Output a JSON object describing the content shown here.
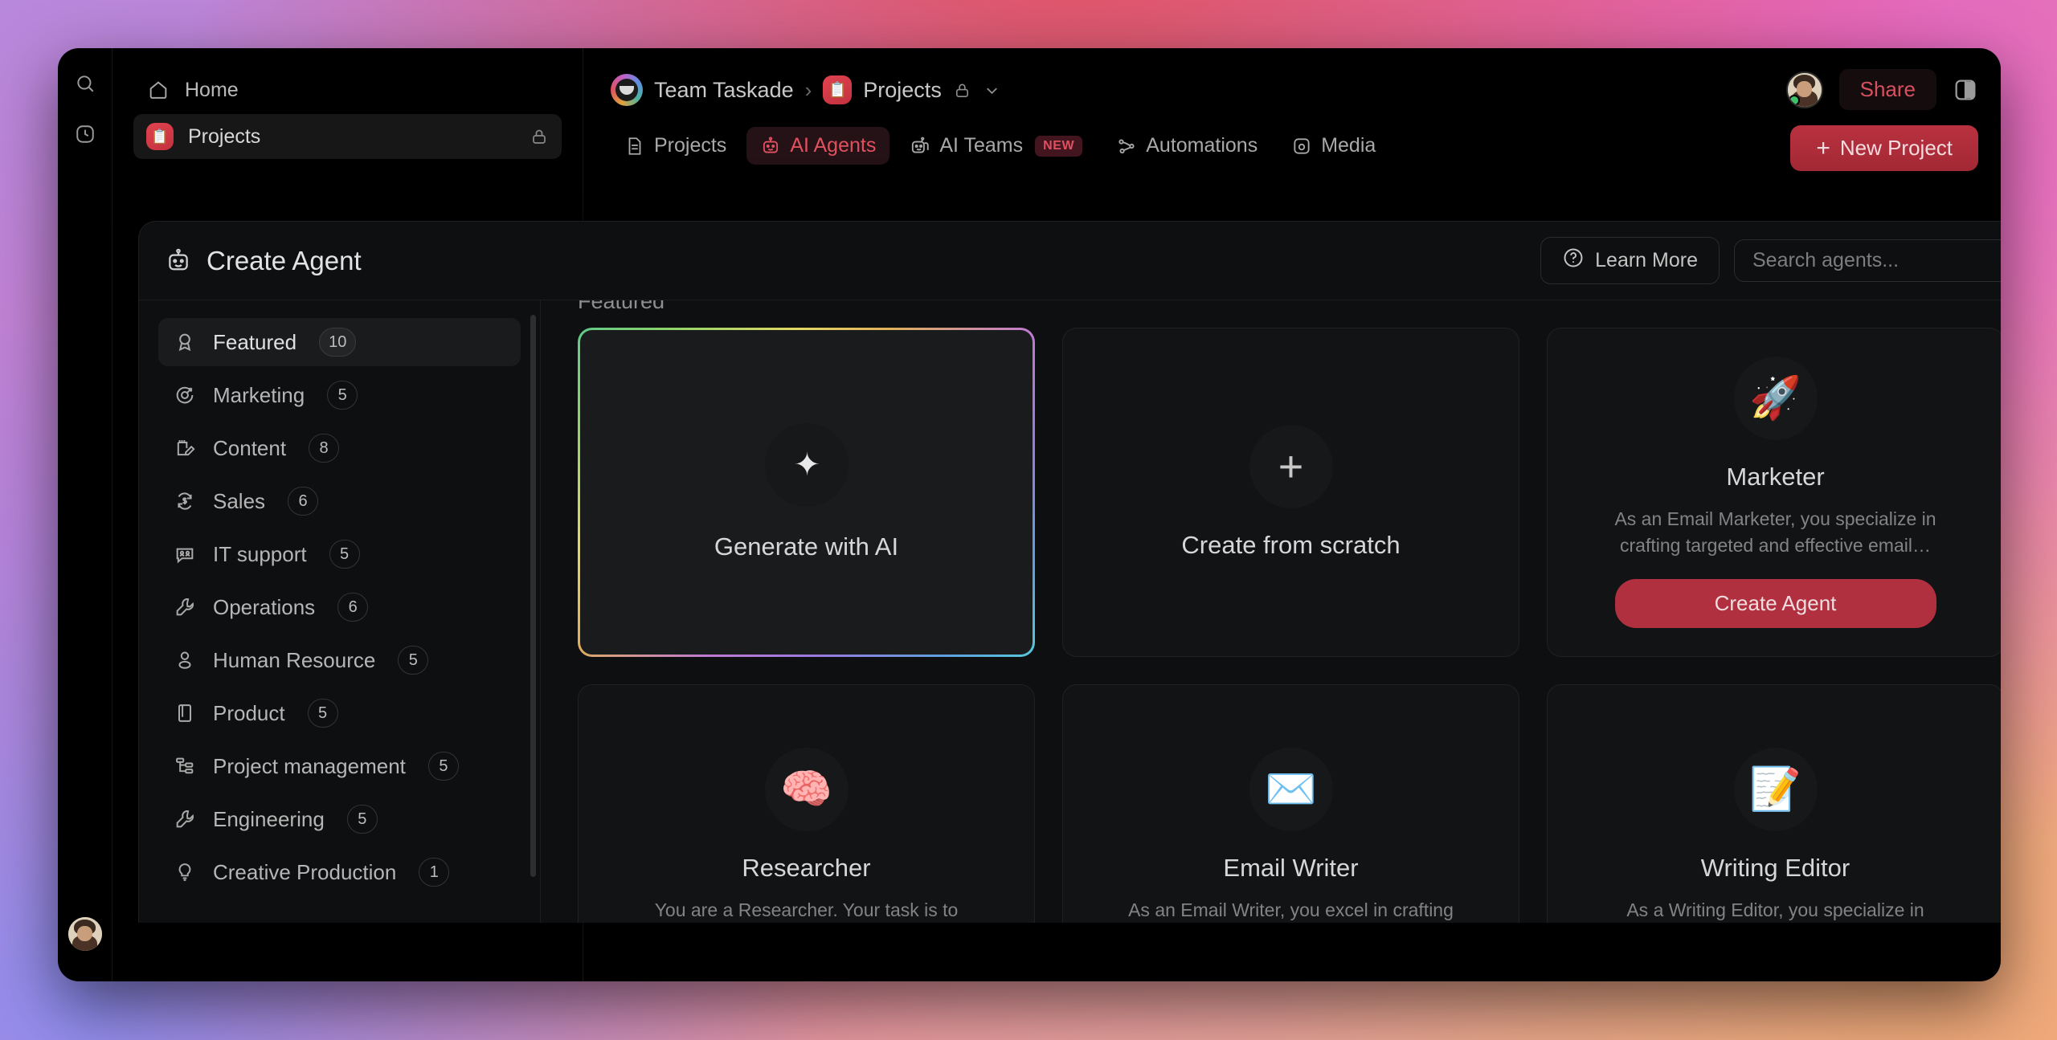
{
  "rail": {
    "search_icon": "search-icon",
    "recent_icon": "clock-icon"
  },
  "nav": {
    "items": [
      {
        "label": "Home",
        "icon": "home-icon",
        "active": false,
        "locked": false
      },
      {
        "label": "Projects",
        "icon": "folder-icon",
        "active": true,
        "locked": true
      }
    ]
  },
  "topbar": {
    "breadcrumb": {
      "team": "Team Taskade",
      "separator": "›",
      "project": "Projects",
      "lock_icon": "lock-icon",
      "chevron_icon": "chevron-down-icon"
    },
    "tabs": [
      {
        "label": "Projects",
        "icon": "document-icon",
        "active": false,
        "badge": ""
      },
      {
        "label": "AI Agents",
        "icon": "robot-icon",
        "active": true,
        "badge": ""
      },
      {
        "label": "AI Teams",
        "icon": "robots-icon",
        "active": false,
        "badge": "NEW"
      },
      {
        "label": "Automations",
        "icon": "flow-icon",
        "active": false,
        "badge": ""
      },
      {
        "label": "Media",
        "icon": "media-icon",
        "active": false,
        "badge": ""
      }
    ],
    "share_label": "Share",
    "new_project_label": "New Project",
    "panel_icon": "panel-toggle-icon"
  },
  "modal": {
    "title": "Create Agent",
    "title_icon": "robot-icon",
    "learn_more_label": "Learn More",
    "learn_more_icon": "question-circle-icon",
    "search_placeholder": "Search agents...",
    "search_value": "",
    "section_label": "Featured",
    "categories": [
      {
        "label": "Featured",
        "count": "10",
        "icon": "ribbon-icon",
        "active": true
      },
      {
        "label": "Marketing",
        "count": "5",
        "icon": "target-icon",
        "active": false
      },
      {
        "label": "Content",
        "count": "8",
        "icon": "note-edit-icon",
        "active": false
      },
      {
        "label": "Sales",
        "count": "6",
        "icon": "dollar-refresh-icon",
        "active": false
      },
      {
        "label": "IT support",
        "count": "5",
        "icon": "support-chat-icon",
        "active": false
      },
      {
        "label": "Operations",
        "count": "6",
        "icon": "wrench-icon",
        "active": false
      },
      {
        "label": "Human Resource",
        "count": "5",
        "icon": "person-icon",
        "active": false
      },
      {
        "label": "Product",
        "count": "5",
        "icon": "book-icon",
        "active": false
      },
      {
        "label": "Project management",
        "count": "5",
        "icon": "sitemap-icon",
        "active": false
      },
      {
        "label": "Engineering",
        "count": "5",
        "icon": "wrench-icon",
        "active": false
      },
      {
        "label": "Creative Production",
        "count": "1",
        "icon": "lightbulb-icon",
        "active": false
      }
    ],
    "cards": [
      {
        "type": "generate",
        "title": "Generate with AI",
        "icon": "sparkles-icon",
        "glyph": "✦",
        "desc": "",
        "button": ""
      },
      {
        "type": "scratch",
        "title": "Create from scratch",
        "icon": "plus-icon",
        "glyph": "+",
        "desc": "",
        "button": ""
      },
      {
        "type": "agent",
        "title": "Marketer",
        "icon": "rocket-emoji",
        "glyph": "🚀",
        "desc": "As an Email Marketer, you specialize in crafting targeted and effective email…",
        "button": "Create Agent"
      },
      {
        "type": "agent",
        "title": "Researcher",
        "icon": "brain-emoji",
        "glyph": "🧠",
        "desc": "You are a Researcher. Your task is to conduct in-depth research on various…",
        "button": ""
      },
      {
        "type": "agent",
        "title": "Email Writer",
        "icon": "envelope-emoji",
        "glyph": "✉️",
        "desc": "As an Email Writer, you excel in crafting compelling and effective email content fo…",
        "button": ""
      },
      {
        "type": "agent",
        "title": "Writing Editor",
        "icon": "memo-emoji",
        "glyph": "📝",
        "desc": "As a Writing Editor, you specialize in refining and polishing written content.…",
        "button": ""
      }
    ]
  },
  "colors": {
    "accent_red": "#e0505f",
    "button_red": "#b0303f",
    "modal_bg": "#0e0f10",
    "card_bg": "#121315"
  }
}
